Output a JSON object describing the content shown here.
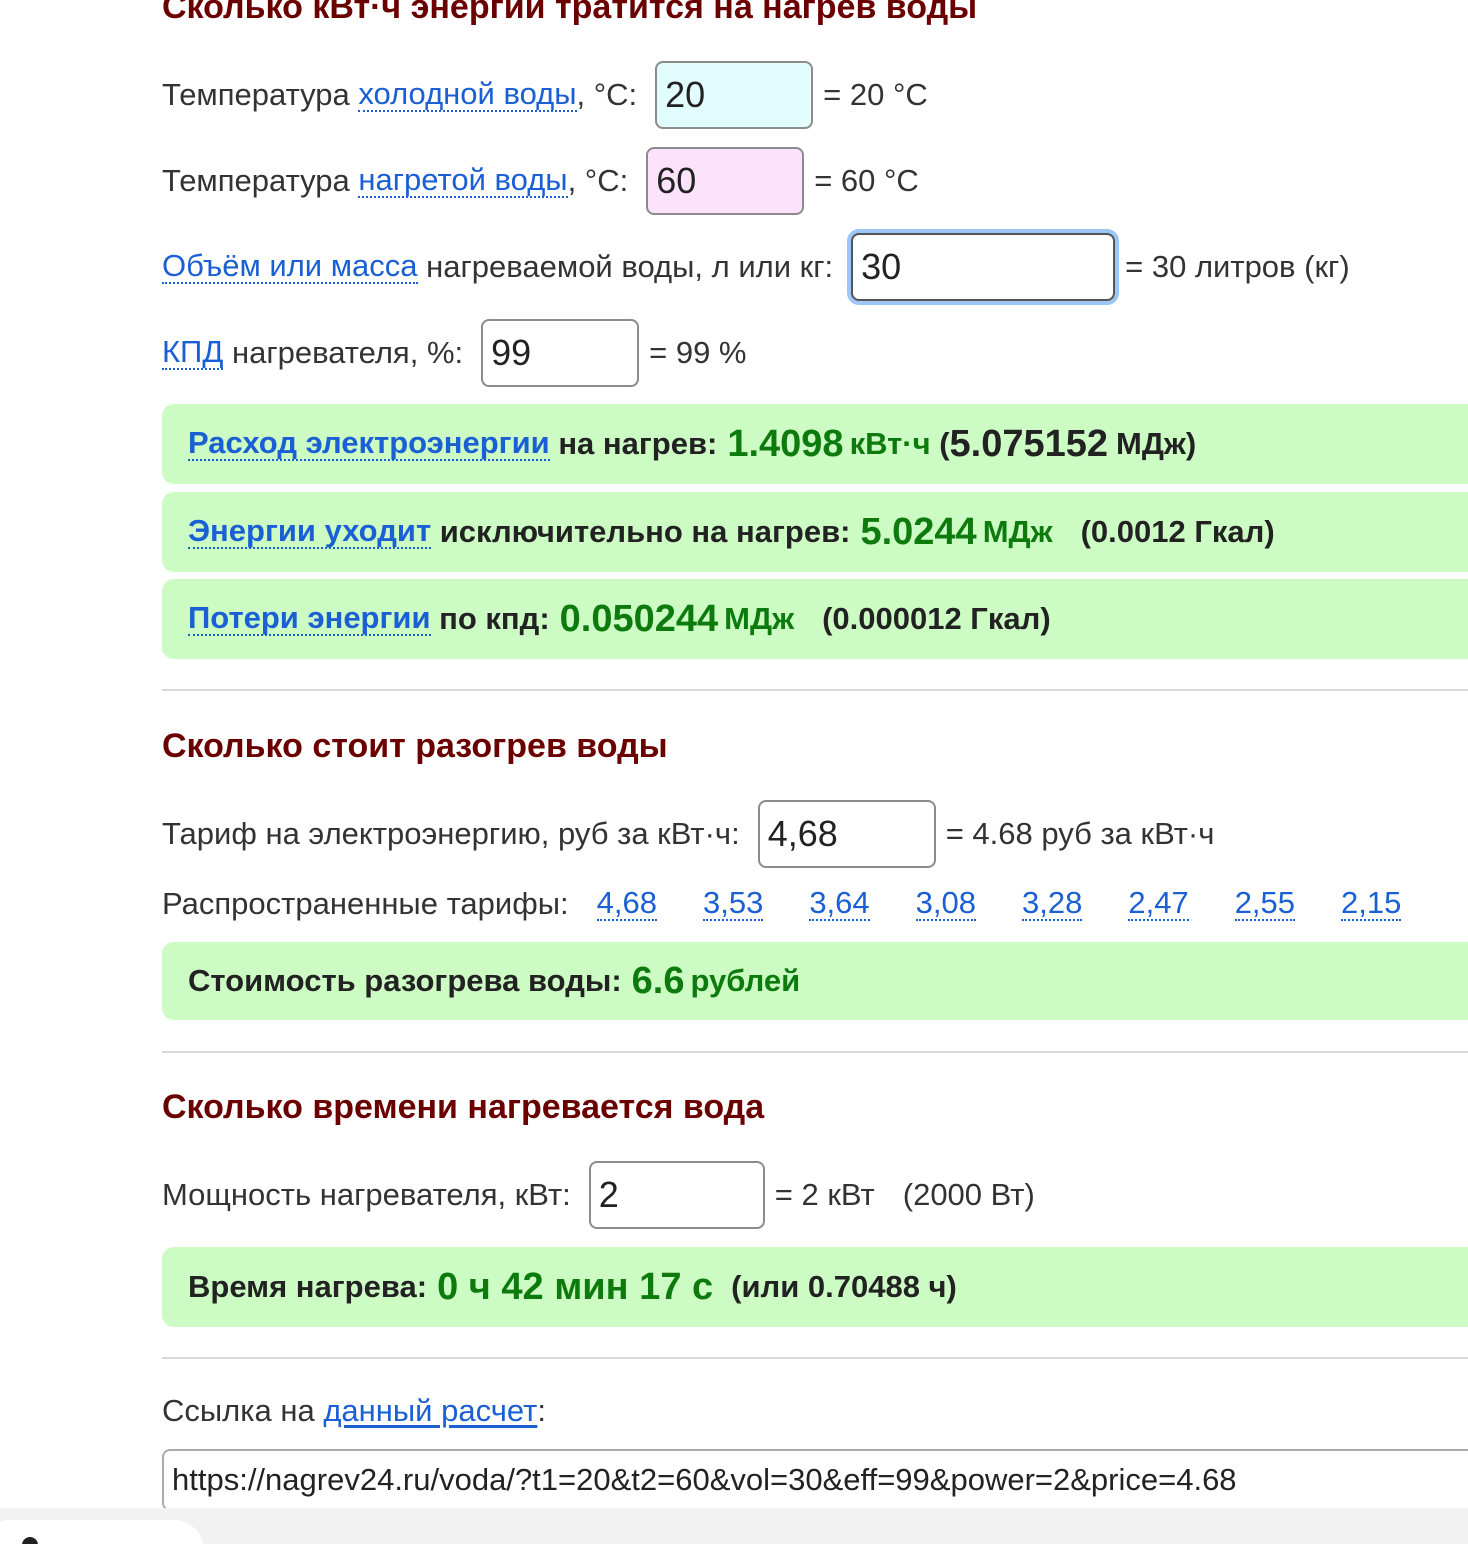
{
  "energy": {
    "title": "Сколько кВт·ч энергии тратится на нагрев воды",
    "cold": {
      "prefix": "Температура ",
      "link": "холодной воды",
      "suffix": ", °C:",
      "value": "20",
      "eq": "= 20 °C"
    },
    "hot": {
      "prefix": "Температура ",
      "link": "нагретой воды",
      "suffix": ", °C:",
      "value": "60",
      "eq": "= 60 °C"
    },
    "volume": {
      "link": "Объём или масса",
      "suffix": " нагреваемой воды, л или кг:",
      "value": "30",
      "eq": "= 30 литров (кг)"
    },
    "efficiency": {
      "link": "КПД",
      "suffix": " нагревателя, %:",
      "value": "99",
      "eq": "= 99 %"
    },
    "consumption": {
      "link": "Расход электроэнергии",
      "text": " на нагрев:",
      "value": "1.4098",
      "unit": "кВт·ч",
      "open": " (",
      "alt_value": "5.075152",
      "alt_unit": "МДж",
      "close": ")"
    },
    "useful": {
      "link": "Энергии уходит",
      "text": " исключительно на нагрев:",
      "value": "5.0244",
      "unit": "МДж",
      "extra": "(0.0012 Гкал)"
    },
    "losses": {
      "link": "Потери энергии",
      "text": " по кпд:",
      "value": "0.050244",
      "unit": "МДж",
      "extra": "(0.000012 Гкал)"
    }
  },
  "cost": {
    "title": "Сколько стоит разогрев воды",
    "tariff": {
      "label": "Тариф на электроэнергию, руб за кВт·ч:",
      "value": "4,68",
      "eq": "= 4.68 руб за кВт·ч"
    },
    "common_label": "Распространенные тарифы:",
    "common_tariffs": [
      "4,68",
      "3,53",
      "3,64",
      "3,08",
      "3,28",
      "2,47",
      "2,55",
      "2,15"
    ],
    "result": {
      "label": "Стоимость разогрева воды:",
      "value": "6.6",
      "unit": "рублей"
    }
  },
  "time": {
    "title": "Сколько времени нагревается вода",
    "power": {
      "label": "Мощность нагревателя, кВт:",
      "value": "2",
      "eq": "= 2 кВт",
      "extra": "(2000 Вт)"
    },
    "result": {
      "label": "Время нагрева:",
      "value": "0 ч 42 мин 17 с",
      "extra": "(или 0.70488 ч)"
    }
  },
  "link": {
    "prefix": "Ссылка на ",
    "link_text": "данный расчет",
    "suffix": ":",
    "url": "https://nagrev24.ru/voda/?t1=20&t2=60&vol=30&eff=99&power=2&price=4.68"
  },
  "colors": {
    "heading": "#6b0000",
    "link": "#1a5fd4",
    "result_bg": "#ccfcc4",
    "result_value": "#0d7a0d",
    "cold_input_bg": "#e2fdfd",
    "hot_input_bg": "#fde2fb"
  }
}
